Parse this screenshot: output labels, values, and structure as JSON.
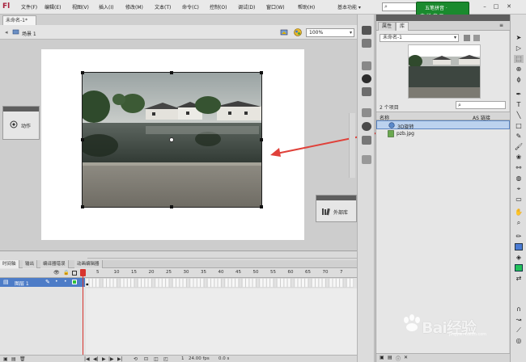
{
  "app": {
    "logo_text": "Fl",
    "workspace_label": "基本功能 ▾",
    "search_placeholder": ""
  },
  "menu": [
    "文件(F)",
    "编辑(E)",
    "视图(V)",
    "插入(I)",
    "修改(M)",
    "文本(T)",
    "命令(C)",
    "控制(O)",
    "调试(D)",
    "窗口(W)",
    "帮助(H)"
  ],
  "badge": {
    "line1": "五笔拼音 ·",
    "line2": "中 拼 音 ☰"
  },
  "document": {
    "tab": "未命名-1*",
    "scene": "场景 1",
    "zoom": "100%"
  },
  "panels": {
    "actions": "动作",
    "library_float": "外部库"
  },
  "library": {
    "tabs": [
      "属性",
      "库"
    ],
    "doc_select": "未命名-1",
    "item_count": "2 个项目",
    "columns": {
      "name": "名称",
      "linkage": "AS 链接"
    },
    "items": [
      {
        "name": "3D旋转",
        "type": "movieclip"
      },
      {
        "name": "pzb.jpg",
        "type": "bitmap"
      }
    ]
  },
  "timeline": {
    "tabs": [
      "时间轴",
      "输出",
      "编译器错误",
      "动画编辑器"
    ],
    "layer_name": "图层 1",
    "frame_numbers": [
      "5",
      "10",
      "15",
      "20",
      "25",
      "30",
      "35",
      "40",
      "45",
      "50",
      "55",
      "60",
      "65",
      "70",
      "7"
    ],
    "current_frame": "1",
    "fps": "24.00 fps",
    "elapsed": "0.0 s"
  },
  "watermark": {
    "text": "Bai经验",
    "sub": "jingyan.baidu.com"
  },
  "colors": {
    "accent_green": "#1a8a2e",
    "layer_selected": "#4d7cc7",
    "playhead": "#d8342e",
    "arrow": "#e0413a"
  }
}
